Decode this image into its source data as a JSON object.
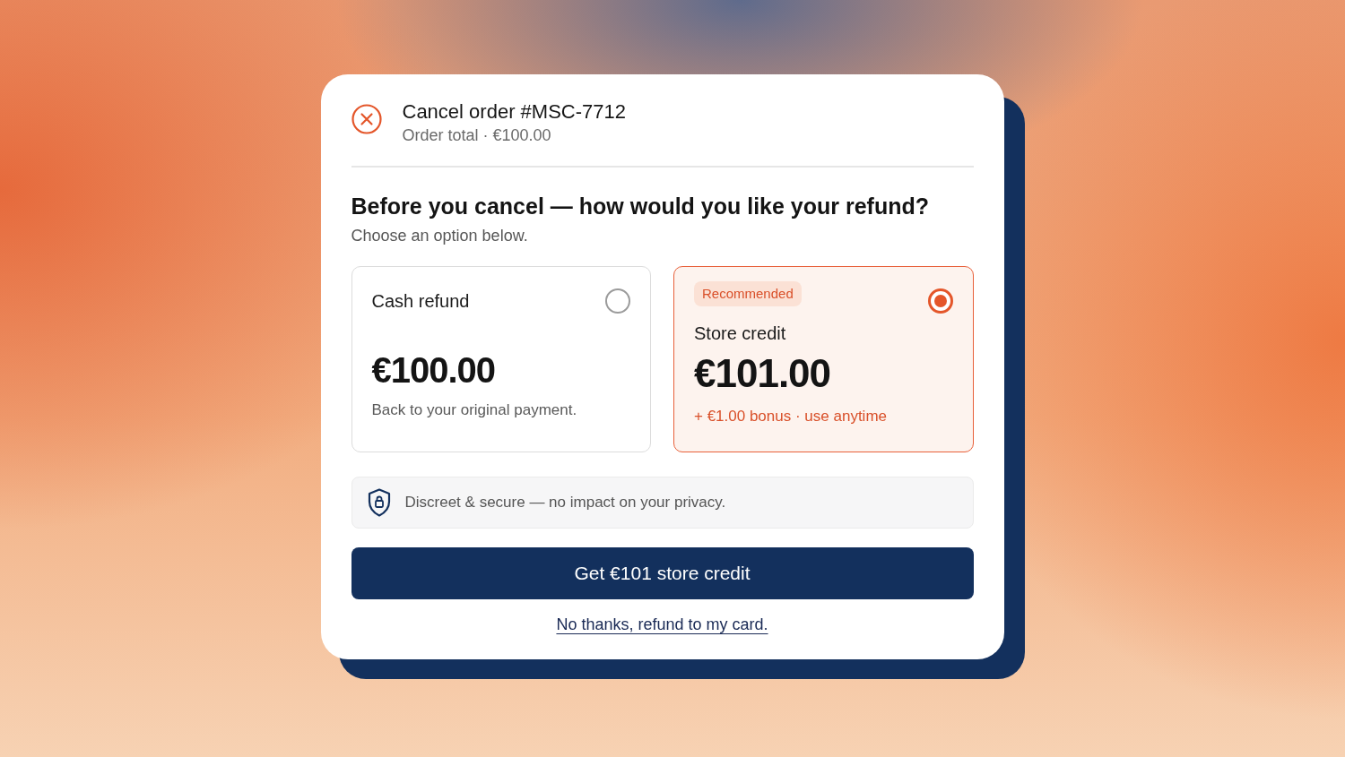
{
  "header": {
    "title": "Cancel order #MSC-7712",
    "subtitle": "Order total · €100.00"
  },
  "question": {
    "heading": "Before you cancel — how would you like your refund?",
    "hint": "Choose an option below."
  },
  "options": [
    {
      "title": "Cash refund",
      "amount": "€100.00",
      "note": "Back to your original payment.",
      "selected": false
    },
    {
      "badge": "Recommended",
      "title": "Store credit",
      "amount": "€101.00",
      "note": "+ €1.00 bonus · use anytime",
      "selected": true
    }
  ],
  "notice": {
    "text": "Discreet & secure — no impact on your privacy."
  },
  "primary_button": {
    "label": "Get €101 store credit"
  },
  "decline_link": {
    "label": "No thanks, refund to my card."
  }
}
